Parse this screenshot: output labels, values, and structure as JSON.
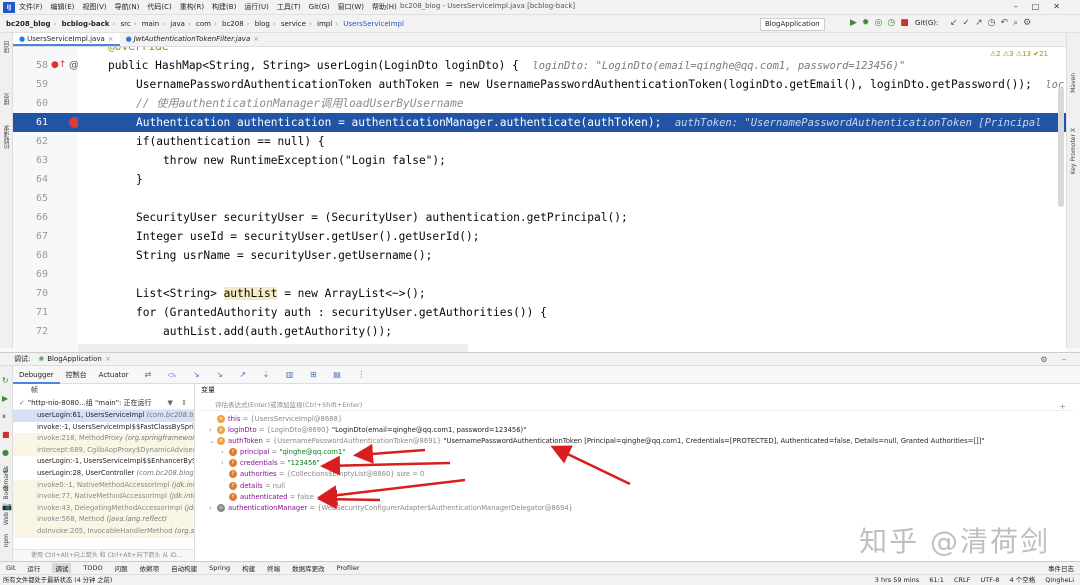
{
  "menubar": {
    "logo": "IJ",
    "items": [
      "文件(F)",
      "编辑(E)",
      "视图(V)",
      "导航(N)",
      "代码(C)",
      "重构(R)",
      "构建(B)",
      "运行(U)",
      "工具(T)",
      "Git(G)",
      "窗口(W)",
      "帮助(H)"
    ],
    "window_title": "bc208_blog - UsersServiceImpl.java [bcblog-back]"
  },
  "breadcrumb": {
    "project": "bc208_blog",
    "module": "bcblog-back",
    "path": [
      "src",
      "main",
      "java",
      "com",
      "bc208",
      "blog",
      "service",
      "impl"
    ],
    "cls": "UsersServiceImpl"
  },
  "toolbar": {
    "run_config": "BlogApplication",
    "git_label": "Git(G):"
  },
  "editor": {
    "tabs": [
      {
        "label": "UsersServiceImpl.java",
        "active": true
      },
      {
        "label": "JwtAuthenticationTokenFilter.java",
        "active": false
      }
    ],
    "inspection": "⚠2  ⚠3  ⚠13  ✔21",
    "annotation_partial": "@Override",
    "line_numbers": [
      "58",
      "59",
      "60",
      "61",
      "62",
      "63",
      "64",
      "65",
      "66",
      "67",
      "68",
      "69",
      "70",
      "71",
      "72"
    ],
    "lines": {
      "l58a": "public HashMap<String, String> userLogin(LoginDto loginDto) {",
      "l58h": "loginDto: \"LoginDto(email=qinghe@qq.com1, password=123456)\"",
      "l59": "UsernamePasswordAuthenticationToken authToken = new UsernamePasswordAuthenticationToken(loginDto.getEmail(), loginDto.getPassword());",
      "l59h": "loc",
      "l60": "// 使用authenticationManager调用loadUserByUsername",
      "l61": "Authentication authentication = authenticationManager.authenticate(authToken);",
      "l61h": "authToken: \"UsernamePasswordAuthenticationToken [Principal",
      "l62": "if(authentication == null) {",
      "l63": "throw new RuntimeException(\"Login false\");",
      "l64": "}",
      "l66": "SecurityUser securityUser = (SecurityUser) authentication.getPrincipal();",
      "l67": "Integer useId = securityUser.getUser().getUserId();",
      "l68": "String usrName = securityUser.getUsername();",
      "l70a": "List<String> ",
      "l70b": "authList",
      "l70c": " = new ArrayList<~>();",
      "l71": "for (GrantedAuthority auth : securityUser.getAuthorities()) {",
      "l72": "authList.add(auth.getAuthority());"
    }
  },
  "debug": {
    "title": "调试:",
    "session": "BlogApplication",
    "tabs": [
      "Debugger",
      "控制台",
      "Actuator"
    ],
    "frames_header": "帧",
    "vars_header": "变量",
    "thread": "\"http-nio-8080...组 \"main\": 正在运行",
    "frames": [
      {
        "method": "userLogin:61, UsersServiceImpl",
        "loc": "(com.bc208.blog",
        "kind": "sel"
      },
      {
        "method": "invoke:-1, UsersServiceImpl$$FastClassBySpring",
        "loc": "",
        "kind": ""
      },
      {
        "method": "invoke:218, MethodProxy",
        "loc": "(org.springframework",
        "kind": "lib"
      },
      {
        "method": "intercept:689, CglibAopProxy$DynamicAdvisedIn",
        "loc": "",
        "kind": "lib"
      },
      {
        "method": "userLogin:-1, UsersServiceImpl$$EnhancerBySpr",
        "loc": "",
        "kind": ""
      },
      {
        "method": "userLogin:28, UserController",
        "loc": "(com.bc208.blog.co",
        "kind": ""
      },
      {
        "method": "invoke0:-1, NativeMethodAccessorImpl",
        "loc": "(jdk.inte",
        "kind": "lib"
      },
      {
        "method": "invoke:77, NativeMethodAccessorImpl",
        "loc": "(jdk.inter",
        "kind": "lib"
      },
      {
        "method": "invoke:43, DelegatingMethodAccessorImpl",
        "loc": "(jdk.i",
        "kind": "lib"
      },
      {
        "method": "invoke:568, Method",
        "loc": "(java.lang.reflect)",
        "kind": "lib"
      },
      {
        "method": "doInvoke:205, InvocableHandlerMethod",
        "loc": "(org.sp",
        "kind": "lib"
      }
    ],
    "frames_footer": "使用 Ctrl+Alt+向上箭头 和 Ctrl+Alt+向下箭头 从 ID...",
    "expr_placeholder": "评估表达式(Enter)或添加监视(Ctrl+Shift+Enter)",
    "vars": [
      {
        "indent": 0,
        "arrow": "",
        "icon": "≡",
        "name": "this",
        "type": " = {UsersServiceImpl@8688}",
        "value": ""
      },
      {
        "indent": 0,
        "arrow": "›",
        "icon": "p",
        "name": "loginDto",
        "type": " = {LoginDto@8690} ",
        "value": "\"LoginDto(email=qinghe@qq.com1, password=123456)\""
      },
      {
        "indent": 0,
        "arrow": "⌄",
        "icon": "≡",
        "name": "authToken",
        "type": " = {UsernamePasswordAuthenticationToken@8691} ",
        "value": "\"UsernamePasswordAuthenticationToken [Principal=qinghe@qq.com1, Credentials=[PROTECTED], Authenticated=false, Details=null, Granted Authorities=[]]\""
      },
      {
        "indent": 1,
        "arrow": "›",
        "icon": "f",
        "name": "principal",
        "type": " = ",
        "value": "\"qinghe@qq.com1\""
      },
      {
        "indent": 1,
        "arrow": "›",
        "icon": "f",
        "name": "credentials",
        "type": " = ",
        "value": "\"123456\""
      },
      {
        "indent": 1,
        "arrow": "",
        "icon": "f",
        "name": "authorities",
        "type": " = {Collections$EmptyList@8860}  size = 0",
        "value": ""
      },
      {
        "indent": 1,
        "arrow": "",
        "icon": "f",
        "name": "details",
        "type": " = null",
        "value": ""
      },
      {
        "indent": 1,
        "arrow": "",
        "icon": "f",
        "name": "authenticated",
        "type": " = false",
        "value": ""
      },
      {
        "indent": 0,
        "arrow": "›",
        "icon": "∞",
        "name": "authenticationManager",
        "type": " = {WebSecurityConfigurerAdapter$AuthenticationManagerDelegator@8694}",
        "value": ""
      }
    ]
  },
  "watermark": "知乎 @清荷剑",
  "bottom_tools": [
    "Git",
    "运行",
    "调试",
    "TODO",
    "问题",
    "依赖项",
    "自动构建",
    "Spring",
    "构建",
    "终端",
    "数据库更改",
    "Profiler"
  ],
  "bottom_tools_right": "事件日志",
  "status": {
    "message": "所有文件都处于最新状态 (4 分钟 之前)",
    "time": "3 hrs 59 mins",
    "pos": "61:1",
    "eol": "CRLF",
    "enc": "UTF-8",
    "indent": "4 个空格",
    "user": "QingheLi"
  },
  "colors": {
    "highlight": "#2154a5",
    "keyword": "#0033b3",
    "arrow_red": "#d81e1e"
  }
}
